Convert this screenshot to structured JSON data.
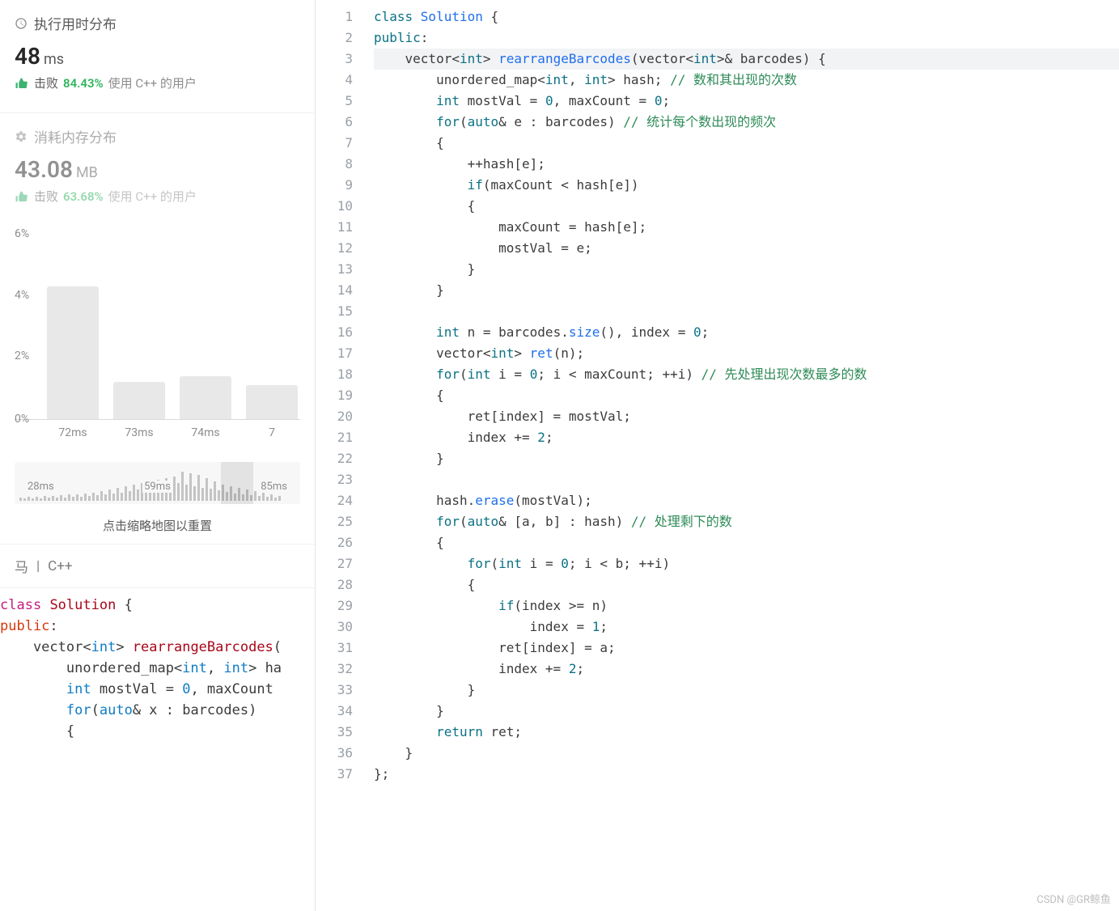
{
  "runtime": {
    "header": "执行用时分布",
    "value": "48",
    "unit": "ms",
    "beat_label": "击败",
    "beat_pct": "84.43%",
    "beat_suffix": "使用 C++ 的用户"
  },
  "memory": {
    "header": "消耗内存分布",
    "value": "43.08",
    "unit": "MB",
    "beat_label": "击败",
    "beat_pct": "63.68%",
    "beat_suffix": "使用 C++ 的用户"
  },
  "chart_data": {
    "type": "bar",
    "y_labels": [
      "6%",
      "4%",
      "2%",
      "0%"
    ],
    "categories": [
      "72ms",
      "73ms",
      "74ms",
      "7"
    ],
    "values": [
      4.3,
      1.2,
      1.4,
      1.1
    ],
    "ylim": [
      0,
      6
    ]
  },
  "minimap": {
    "labels": [
      "28ms",
      "59ms",
      "85ms"
    ],
    "hint": "点击缩略地图以重置"
  },
  "lang_bar": {
    "left": "马",
    "sep": "|",
    "lang": "C++"
  },
  "preview": {
    "l1_a": "class",
    "l1_b": "Solution",
    "l1_c": " {",
    "l2_a": "public",
    "l2_b": ":",
    "l3_a": "    vector<",
    "l3_b": "int",
    "l3_c": "> ",
    "l3_d": "rearrangeBarcodes",
    "l3_e": "(",
    "l4": "        unordered_map<",
    "l4_b": "int",
    "l4_c": ", ",
    "l4_d": "int",
    "l4_e": "> ha",
    "l5": "        ",
    "l5_b": "int",
    "l5_c": " mostVal = ",
    "l5_d": "0",
    "l5_e": ", maxCount ",
    "l6": "        ",
    "l6_b": "for",
    "l6_c": "(",
    "l6_d": "auto",
    "l6_e": "& x : barcodes)",
    "l7": "        {"
  },
  "code": {
    "lines": [
      {
        "n": 1,
        "seg": [
          [
            "tk-kw",
            "class "
          ],
          [
            "tk-func",
            "Solution"
          ],
          [
            "tk-punc",
            " {"
          ]
        ]
      },
      {
        "n": 2,
        "seg": [
          [
            "tk-kw",
            "public"
          ],
          [
            "tk-punc",
            ":"
          ]
        ]
      },
      {
        "n": 3,
        "hl": true,
        "seg": [
          [
            "tk-punc",
            "    vector<"
          ],
          [
            "tk-kw",
            "int"
          ],
          [
            "tk-punc",
            "> "
          ],
          [
            "tk-func",
            "rearrangeBarcodes"
          ],
          [
            "tk-punc",
            "(vector<"
          ],
          [
            "tk-kw",
            "int"
          ],
          [
            "tk-punc",
            ">& barcodes) {"
          ]
        ]
      },
      {
        "n": 4,
        "seg": [
          [
            "tk-punc",
            "        unordered_map<"
          ],
          [
            "tk-kw",
            "int"
          ],
          [
            "tk-punc",
            ", "
          ],
          [
            "tk-kw",
            "int"
          ],
          [
            "tk-punc",
            "> hash; "
          ],
          [
            "tk-cmt",
            "// 数和其出现的次数"
          ]
        ]
      },
      {
        "n": 5,
        "seg": [
          [
            "tk-punc",
            "        "
          ],
          [
            "tk-kw",
            "int"
          ],
          [
            "tk-punc",
            " mostVal = "
          ],
          [
            "tk-num",
            "0"
          ],
          [
            "tk-punc",
            ", maxCount = "
          ],
          [
            "tk-num",
            "0"
          ],
          [
            "tk-punc",
            ";"
          ]
        ]
      },
      {
        "n": 6,
        "seg": [
          [
            "tk-punc",
            "        "
          ],
          [
            "tk-kw",
            "for"
          ],
          [
            "tk-punc",
            "("
          ],
          [
            "tk-kw",
            "auto"
          ],
          [
            "tk-punc",
            "& e : barcodes) "
          ],
          [
            "tk-cmt",
            "// 统计每个数出现的频次"
          ]
        ]
      },
      {
        "n": 7,
        "seg": [
          [
            "tk-punc",
            "        {"
          ]
        ]
      },
      {
        "n": 8,
        "seg": [
          [
            "tk-punc",
            "            ++hash[e];"
          ]
        ]
      },
      {
        "n": 9,
        "seg": [
          [
            "tk-punc",
            "            "
          ],
          [
            "tk-kw",
            "if"
          ],
          [
            "tk-punc",
            "(maxCount < hash[e])"
          ]
        ]
      },
      {
        "n": 10,
        "seg": [
          [
            "tk-punc",
            "            {"
          ]
        ]
      },
      {
        "n": 11,
        "seg": [
          [
            "tk-punc",
            "                maxCount = hash[e];"
          ]
        ]
      },
      {
        "n": 12,
        "seg": [
          [
            "tk-punc",
            "                mostVal = e;"
          ]
        ]
      },
      {
        "n": 13,
        "seg": [
          [
            "tk-punc",
            "            }"
          ]
        ]
      },
      {
        "n": 14,
        "seg": [
          [
            "tk-punc",
            "        }"
          ]
        ]
      },
      {
        "n": 15,
        "seg": [
          [
            "tk-punc",
            ""
          ]
        ]
      },
      {
        "n": 16,
        "seg": [
          [
            "tk-punc",
            "        "
          ],
          [
            "tk-kw",
            "int"
          ],
          [
            "tk-punc",
            " n = barcodes."
          ],
          [
            "tk-func",
            "size"
          ],
          [
            "tk-punc",
            "(), index = "
          ],
          [
            "tk-num",
            "0"
          ],
          [
            "tk-punc",
            ";"
          ]
        ]
      },
      {
        "n": 17,
        "seg": [
          [
            "tk-punc",
            "        vector<"
          ],
          [
            "tk-kw",
            "int"
          ],
          [
            "tk-punc",
            "> "
          ],
          [
            "tk-func",
            "ret"
          ],
          [
            "tk-punc",
            "(n);"
          ]
        ]
      },
      {
        "n": 18,
        "seg": [
          [
            "tk-punc",
            "        "
          ],
          [
            "tk-kw",
            "for"
          ],
          [
            "tk-punc",
            "("
          ],
          [
            "tk-kw",
            "int"
          ],
          [
            "tk-punc",
            " i = "
          ],
          [
            "tk-num",
            "0"
          ],
          [
            "tk-punc",
            "; i < maxCount; ++i) "
          ],
          [
            "tk-cmt",
            "// 先处理出现次数最多的数"
          ]
        ]
      },
      {
        "n": 19,
        "seg": [
          [
            "tk-punc",
            "        {"
          ]
        ]
      },
      {
        "n": 20,
        "seg": [
          [
            "tk-punc",
            "            ret[index] = mostVal;"
          ]
        ]
      },
      {
        "n": 21,
        "seg": [
          [
            "tk-punc",
            "            index += "
          ],
          [
            "tk-num",
            "2"
          ],
          [
            "tk-punc",
            ";"
          ]
        ]
      },
      {
        "n": 22,
        "seg": [
          [
            "tk-punc",
            "        }"
          ]
        ]
      },
      {
        "n": 23,
        "seg": [
          [
            "tk-punc",
            ""
          ]
        ]
      },
      {
        "n": 24,
        "seg": [
          [
            "tk-punc",
            "        hash."
          ],
          [
            "tk-func",
            "erase"
          ],
          [
            "tk-punc",
            "(mostVal);"
          ]
        ]
      },
      {
        "n": 25,
        "seg": [
          [
            "tk-punc",
            "        "
          ],
          [
            "tk-kw",
            "for"
          ],
          [
            "tk-punc",
            "("
          ],
          [
            "tk-kw",
            "auto"
          ],
          [
            "tk-punc",
            "& [a, b] : hash) "
          ],
          [
            "tk-cmt",
            "// 处理剩下的数"
          ]
        ]
      },
      {
        "n": 26,
        "seg": [
          [
            "tk-punc",
            "        {"
          ]
        ]
      },
      {
        "n": 27,
        "seg": [
          [
            "tk-punc",
            "            "
          ],
          [
            "tk-kw",
            "for"
          ],
          [
            "tk-punc",
            "("
          ],
          [
            "tk-kw",
            "int"
          ],
          [
            "tk-punc",
            " i = "
          ],
          [
            "tk-num",
            "0"
          ],
          [
            "tk-punc",
            "; i < b; ++i)"
          ]
        ]
      },
      {
        "n": 28,
        "seg": [
          [
            "tk-punc",
            "            {"
          ]
        ]
      },
      {
        "n": 29,
        "seg": [
          [
            "tk-punc",
            "                "
          ],
          [
            "tk-kw",
            "if"
          ],
          [
            "tk-punc",
            "(index >= n)"
          ]
        ]
      },
      {
        "n": 30,
        "seg": [
          [
            "tk-punc",
            "                    index = "
          ],
          [
            "tk-num",
            "1"
          ],
          [
            "tk-punc",
            ";"
          ]
        ]
      },
      {
        "n": 31,
        "seg": [
          [
            "tk-punc",
            "                ret[index] = a;"
          ]
        ]
      },
      {
        "n": 32,
        "seg": [
          [
            "tk-punc",
            "                index += "
          ],
          [
            "tk-num",
            "2"
          ],
          [
            "tk-punc",
            ";"
          ]
        ]
      },
      {
        "n": 33,
        "seg": [
          [
            "tk-punc",
            "            }"
          ]
        ]
      },
      {
        "n": 34,
        "seg": [
          [
            "tk-punc",
            "        }"
          ]
        ]
      },
      {
        "n": 35,
        "seg": [
          [
            "tk-punc",
            "        "
          ],
          [
            "tk-kw",
            "return"
          ],
          [
            "tk-punc",
            " ret;"
          ]
        ]
      },
      {
        "n": 36,
        "seg": [
          [
            "tk-punc",
            "    }"
          ]
        ]
      },
      {
        "n": 37,
        "seg": [
          [
            "tk-punc",
            "};"
          ]
        ]
      }
    ]
  },
  "watermark": "CSDN @GR鲸鱼"
}
